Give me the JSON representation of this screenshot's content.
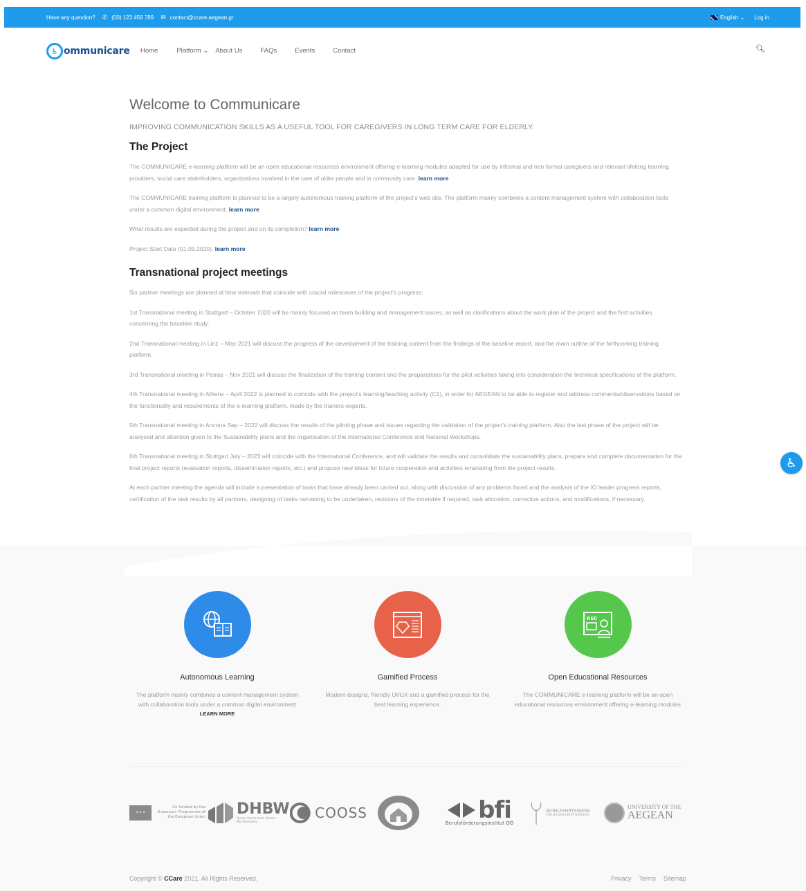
{
  "topbar": {
    "question": "Have any question?",
    "phone": "(00) 123 456 789",
    "email": "contact@ccare.aegean.gr",
    "language": "English",
    "login": "Log in"
  },
  "nav": {
    "logo_text": "ommunicare",
    "items": [
      "Home",
      "Platform",
      "About Us",
      "FAQs",
      "Events",
      "Contact"
    ]
  },
  "main": {
    "title": "Welcome to Communicare",
    "tagline": "IMPROVING COMMUNICATION SKILLS AS A USEFUL TOOL FOR CAREGIVERS IN LONG TERM CARE FOR ELDERLY.",
    "project_heading": "The Project",
    "project_paragraphs": [
      "The COMMUNICARE e-learning platform will be an open educational resources environment offering e-learning modules adapted for use by informal and non formal caregivers and relevant lifelong learning providers, social care stakeholders, organizations involved in the care of older people and in community care.",
      "The COMMUNICARE training platform is planned to be a largely autonomous training platform of the project's web site. The platform mainly combines a content management system with collaboration tools under a common digital environment.",
      "What results are expected during the project and on its completion?",
      "Project Start Date (01.09.2020)."
    ],
    "learn_more": "learn more",
    "meetings_heading": "Transnational project meetings",
    "meetings_paragraphs": [
      "Six partner meetings are planned at time intervals that coincide with crucial milestones of the project's progress:",
      "1st Transnational meeting in Stuttgart – October 2020 will be mainly focused on team building and management issues, as well as clarifications about the work plan of the project and the first activities concerning the baseline study.",
      "2nd Transnational meeting in Linz – May 2021 will discuss the progress of the development of the training content from the findings of the baseline report, and the main outline of the forthcoming training platform.",
      "3rd Transnational meeting in Patras – Nov 2021 will discuss the finalization of the training content and the preparations for the pilot activities taking into consideration the technical specifications of the platform.",
      "4th Transnational meeting in Athens – April 2022 is planned to coincide with the project's learning/teaching activity (C1), in order for AEGEAN to be able to register and address comments/observations based on the functionality and requirements of the e-learning platform, made by the trainers-experts.",
      "5th Transnational meeting in Ancona Sep – 2022 will discuss the results of the piloting phase and issues regarding the validation of the project's training platform. Also the last phase of the project will be analysed and attention given to the Sustainability plans and the organisation of the International Conference and National Workshops.",
      "6th Transnational meeting in Stuttgart July – 2023 will coincide with the International Conference, and will validate the results and consolidate the sustainability plans, prepare and complete documentation for the final project reports (evaluation reports, dissemination reports, etc.) and propose new ideas for future cooperation and activities emanating from the project results.",
      "At each partner meeting the agenda will include a presentation of tasks that have already been carried out, along with discussion of any problems faced and the analysis of the IO leader progress reports, certification of the task results by all partners, designing of tasks remaining to be undertaken, revisions of the timetable if required, task allocation, corrective actions, and modifications, if necessary."
    ]
  },
  "features": [
    {
      "title": "Autonomous Learning",
      "desc": "The platform mainly combines a content management system with collaboration tools under a common digital environment",
      "link": "LEARN MORE",
      "color": "#2f8be8",
      "icon": "globe-book-icon"
    },
    {
      "title": "Gamified Process",
      "desc": "Modern designs, friendly UI/UX and a gamified process for the best learning experience.",
      "color": "#e8624a",
      "icon": "diamond-screen-icon"
    },
    {
      "title": "Open Educational Resources",
      "desc": "The COMMUNICARE e-learning platform will be an open educational resources environment offering e-learning modules",
      "color": "#55c84c",
      "icon": "rec-teacher-icon"
    }
  ],
  "partners": {
    "erasmus": "Co-funded by the Erasmus+ Programme of the European Union",
    "dhbw": "DHBW",
    "dhbw_sub": "Duale Hochschule Baden-Württemberg",
    "cooss": "COOSS",
    "bfi": "bfi",
    "bfi_sub": "Berufsförderungsinstitut OÖ",
    "wohlfahrt": "WOHLFAHRTSWERK",
    "wohlfahrt_sub": "FÜR BADEN-WÜRTTEMBERG",
    "aegean_top": "UNIVERSITY OF THE",
    "aegean": "AEGEAN"
  },
  "footer": {
    "copyright_pre": "Copyright © ",
    "brand": "CCare",
    "copyright_post": " 2021. All Rights Reserved.",
    "links": [
      "Privacy",
      "Terms",
      "Sitemap"
    ]
  },
  "colors": {
    "accent": "#1e9bea",
    "brand": "#1a4f8f"
  }
}
